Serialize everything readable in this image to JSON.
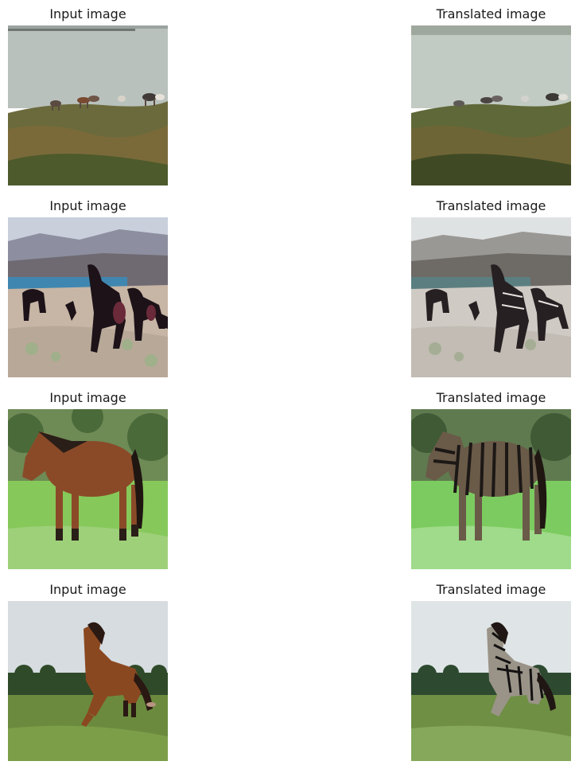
{
  "figure": {
    "rows": [
      {
        "input_title": "Input image",
        "output_title": "Translated image",
        "scene": "herd of horses grazing on a grassy cliff above water"
      },
      {
        "input_title": "Input image",
        "output_title": "Translated image",
        "scene": "dark horses running in a desert canyon near a lake"
      },
      {
        "input_title": "Input image",
        "output_title": "Translated image",
        "scene": "brown horse standing in a green meadow"
      },
      {
        "input_title": "Input image",
        "output_title": "Translated image",
        "scene": "chestnut horse galloping in a field with tree line"
      }
    ]
  }
}
